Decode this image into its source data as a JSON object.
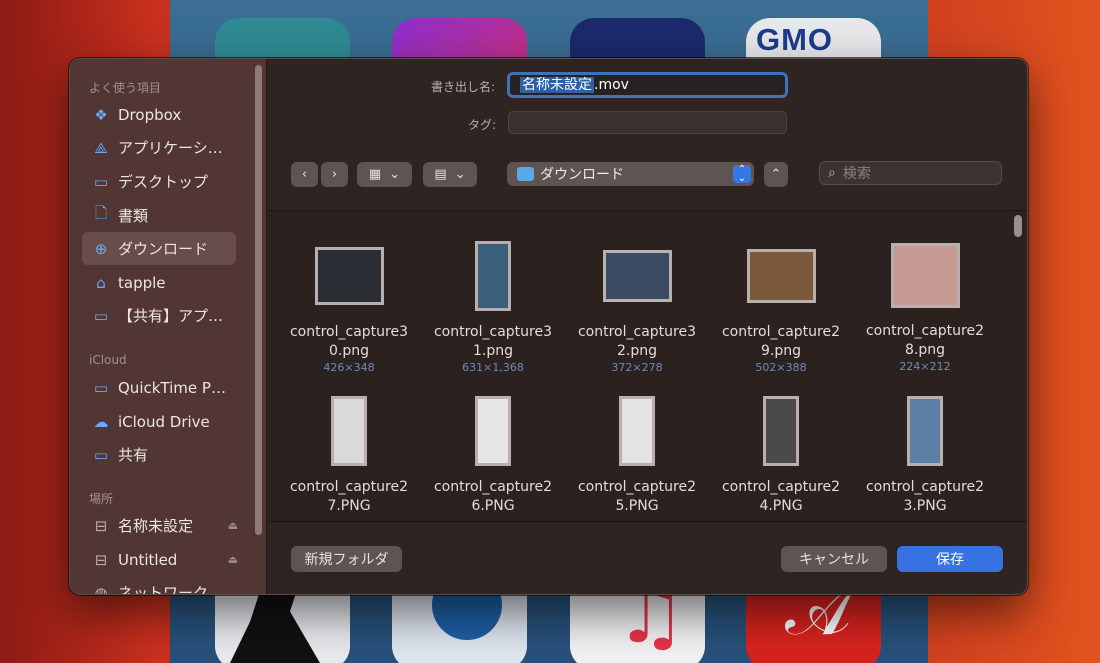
{
  "background": {
    "gmo_logo": "GMO"
  },
  "sidebar": {
    "sections": [
      {
        "label": "よく使う項目"
      },
      {
        "label": "iCloud"
      },
      {
        "label": "場所"
      }
    ],
    "favorites": [
      {
        "label": "Dropbox",
        "icon": "dropbox-icon"
      },
      {
        "label": "アプリケーシ…",
        "icon": "applications-icon"
      },
      {
        "label": "デスクトップ",
        "icon": "desktop-icon"
      },
      {
        "label": "書類",
        "icon": "document-icon"
      },
      {
        "label": "ダウンロード",
        "icon": "download-icon"
      },
      {
        "label": "tapple",
        "icon": "home-icon"
      },
      {
        "label": "【共有】アプリ…",
        "icon": "folder-icon"
      }
    ],
    "icloud": [
      {
        "label": "QuickTime Pl...",
        "icon": "folder-icon"
      },
      {
        "label": "iCloud Drive",
        "icon": "cloud-icon"
      },
      {
        "label": "共有",
        "icon": "shared-folder-icon"
      }
    ],
    "locations": [
      {
        "label": "名称未設定",
        "icon": "drive-icon"
      },
      {
        "label": "Untitled",
        "icon": "drive-icon"
      },
      {
        "label": "ネットワーク",
        "icon": "network-icon"
      }
    ]
  },
  "form": {
    "export_label": "書き出し名:",
    "filename": "名称未設定",
    "extension": ".mov",
    "tags_label": "タグ:"
  },
  "toolbar": {
    "location": "ダウンロード",
    "search_placeholder": "検索"
  },
  "files": [
    {
      "name": "control_capture30.png",
      "dims": "426×348"
    },
    {
      "name": "control_capture31.png",
      "dims": "631×1,368"
    },
    {
      "name": "control_capture32.png",
      "dims": "372×278"
    },
    {
      "name": "control_capture29.png",
      "dims": "502×388"
    },
    {
      "name": "control_capture28.png",
      "dims": "224×212"
    },
    {
      "name": "control_capture27.PNG",
      "dims": ""
    },
    {
      "name": "control_capture26.PNG",
      "dims": ""
    },
    {
      "name": "control_capture25.PNG",
      "dims": ""
    },
    {
      "name": "control_capture24.PNG",
      "dims": ""
    },
    {
      "name": "control_capture23.PNG",
      "dims": ""
    }
  ],
  "buttons": {
    "new_folder": "新規フォルダ",
    "cancel": "キャンセル",
    "save": "保存"
  },
  "colors": {
    "accent": "#3672e0",
    "sidebar_icon": "#6aa7ff"
  }
}
